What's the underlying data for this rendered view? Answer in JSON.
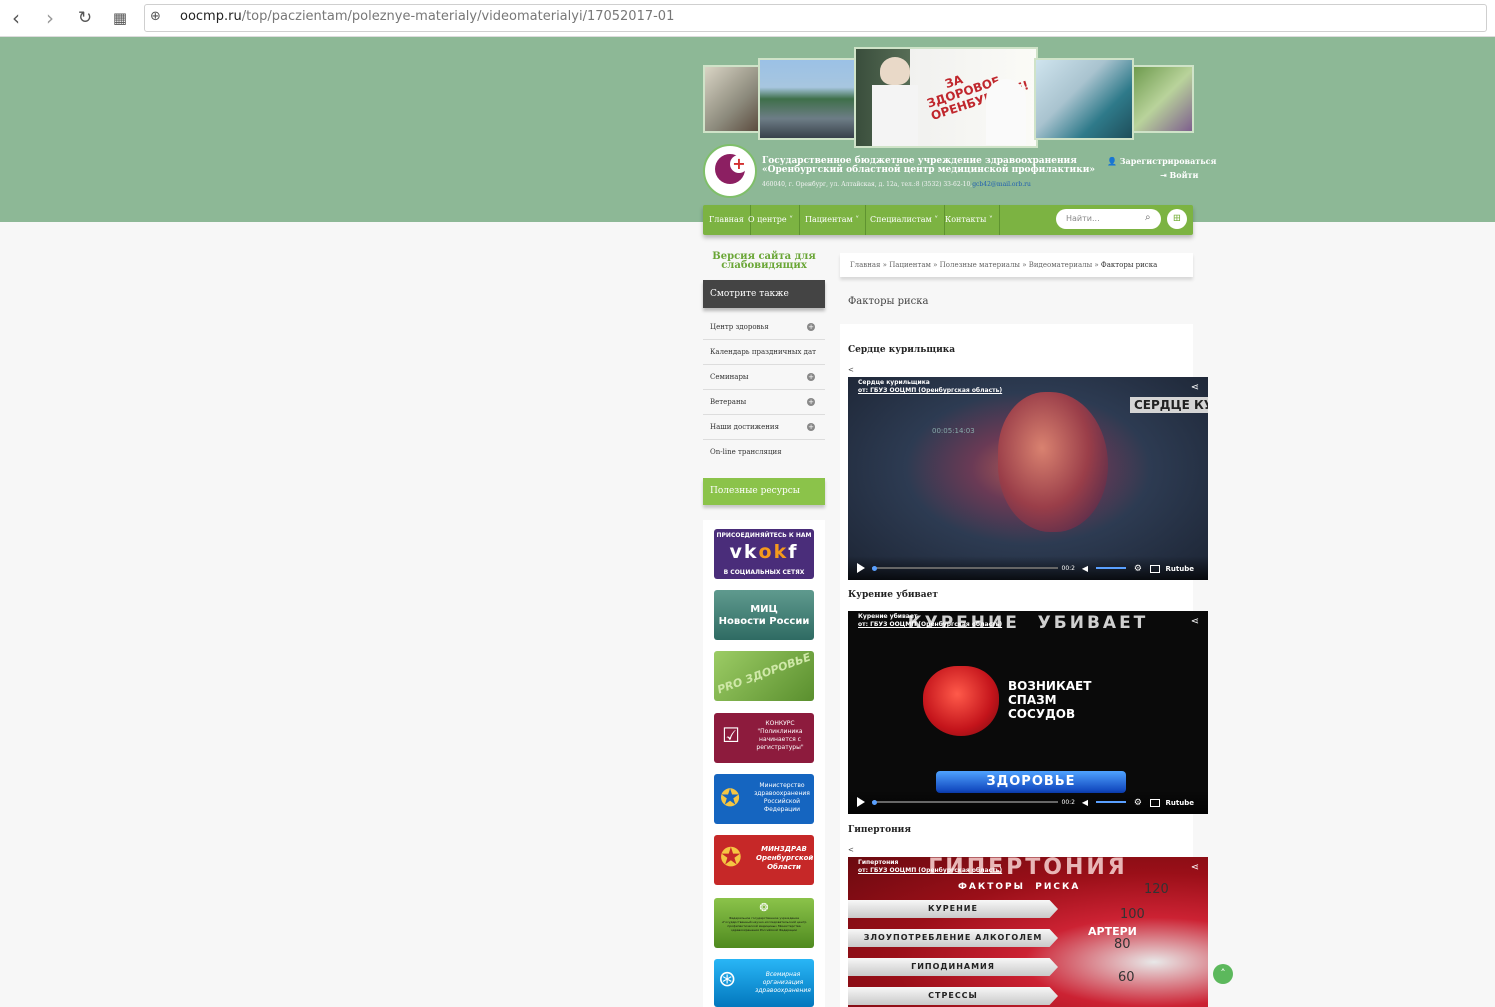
{
  "browser": {
    "url_host": "oocmp.ru",
    "url_path": "/top/paczientam/poleznye-materialy/videomaterialyi/17052017-01"
  },
  "header": {
    "banner_sign_line1": "ЗА ЗДОРОВОЕ",
    "banner_sign_line2": "ОРЕНБУРЖЬЕ!",
    "org_line1": "Государственное бюджетное учреждение здравоохранения",
    "org_line2": "«Оренбургский областной центр медицинской профилактики»",
    "address": "460040, г. Оренбург, ул. Алтайская, д. 12а, тел.:8 (3532) 33-62-10,",
    "email": "gcb42@mail.orb.ru",
    "register_label": "Зарегистрироваться",
    "login_label": "Войти"
  },
  "menu": {
    "items": [
      "Главная",
      "О центре",
      "Пациентам",
      "Специалистам",
      "Контакты"
    ],
    "search_placeholder": "Найти..."
  },
  "sidebar": {
    "low_vision": "Версия сайта для слабовидящих",
    "see_also_title": "Смотрите также",
    "items": [
      "Центр здоровья",
      "Календарь праздничных дат",
      "Семинары",
      "Ветераны",
      "Наши достижения",
      "On-line трансляция"
    ],
    "useful_title": "Полезные ресурсы",
    "banners": {
      "social_top": "ПРИСОЕДИНЯЙТЕСЬ К НАМ",
      "social_bottom": "В СОЦИАЛЬНЫХ СЕТЯХ",
      "mic_line1": "МИЦ",
      "mic_line2": "Новости России",
      "pro_zdorovye": "PRO ЗДОРОВЬЕ",
      "contest": "КОНКУРС \"Поликлиника начинается с регистратуры\"",
      "ministry": "Министерство здравоохранения Российской Федерации",
      "minzdrav_orb": "МИНЗДРАВ Оренбургской Области",
      "federal": "Федеральное государственное учреждение «Государственный научно-исследовательский центр профилактической медицины» Министерства здравоохранения Российской Федерации",
      "who": "Всемирная организация здравоохранения"
    }
  },
  "breadcrumb": {
    "items": [
      "Главная",
      "Пациентам",
      "Полезные материалы",
      "Видеоматериалы"
    ],
    "separator": " » ",
    "current": "Факторы риска"
  },
  "main": {
    "page_title": "Факторы риска",
    "lt_glyph": "<",
    "videos": [
      {
        "title": "Сердце курильщика",
        "player_title": "Сердце курильщика",
        "player_author": "от: ГБУЗ ООЦМП (Оренбургская область)",
        "overlay_text": "СЕРДЦЕ КУР",
        "timecode": "00:05:14:03",
        "time": "00:2",
        "brand": "Rutube"
      },
      {
        "title": "Курение убивает",
        "player_title": "Курение убивает",
        "player_author": "от: ГБУЗ ООЦМП (Оренбургская область)",
        "overlay_text": "КУРЕНИЕ  УБИВАЕТ",
        "overlay_sub1": "ВОЗНИКАЕТ",
        "overlay_sub2": "СПАЗМ",
        "overlay_sub3": "СОСУДОВ",
        "overlay_bottom": "ЗДОРОВЬЕ",
        "time": "00:2",
        "brand": "Rutube"
      },
      {
        "title": "Гипертония",
        "player_title": "Гипертония",
        "player_author": "от: ГБУЗ ООЦМП (Оренбургская область)",
        "overlay_text": "ГИПЕРТОНИЯ",
        "overlay_sub": "ФАКТОРЫ  РИСКА",
        "factors": [
          "КУРЕНИЕ",
          "ЗЛОУПОТРЕБЛЕНИЕ АЛКОГОЛЕМ",
          "ГИПОДИНАМИЯ",
          "СТРЕССЫ"
        ],
        "gauge_label": "АРТЕРИ",
        "gauge_numbers": [
          "120",
          "100",
          "80",
          "60"
        ]
      }
    ]
  },
  "colors": {
    "header_green": "#8db896",
    "menu_green": "#7cb342",
    "useful_green": "#8bc34a",
    "see_also_dark": "#444444"
  }
}
